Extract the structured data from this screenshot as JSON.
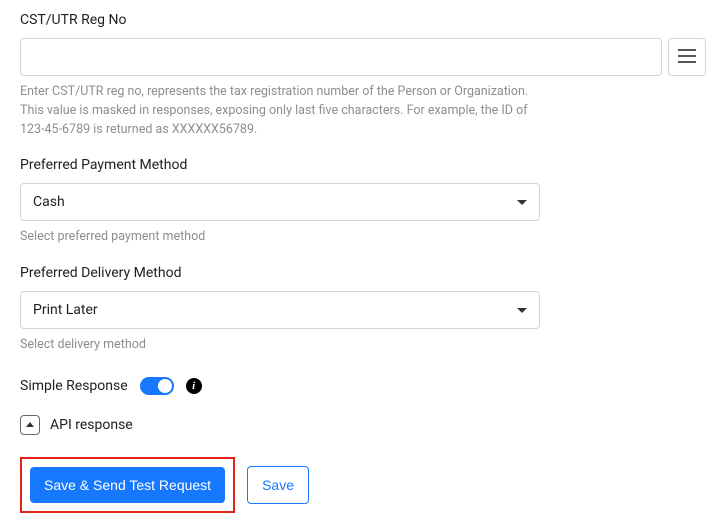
{
  "fields": {
    "cst": {
      "label": "CST/UTR Reg No",
      "value": "",
      "help": "Enter CST/UTR reg no, represents the tax registration number of the Person or Organization. This value is masked in responses, exposing only last five characters. For example, the ID of 123-45-6789 is returned as XXXXXX56789."
    },
    "payment": {
      "label": "Preferred Payment Method",
      "value": "Cash",
      "help": "Select preferred payment method"
    },
    "delivery": {
      "label": "Preferred Delivery Method",
      "value": "Print Later",
      "help": "Select delivery method"
    }
  },
  "simpleResponse": {
    "label": "Simple Response",
    "enabled": true
  },
  "apiResponse": {
    "label": "API response",
    "expanded": true
  },
  "buttons": {
    "saveSend": "Save & Send Test Request",
    "save": "Save"
  }
}
